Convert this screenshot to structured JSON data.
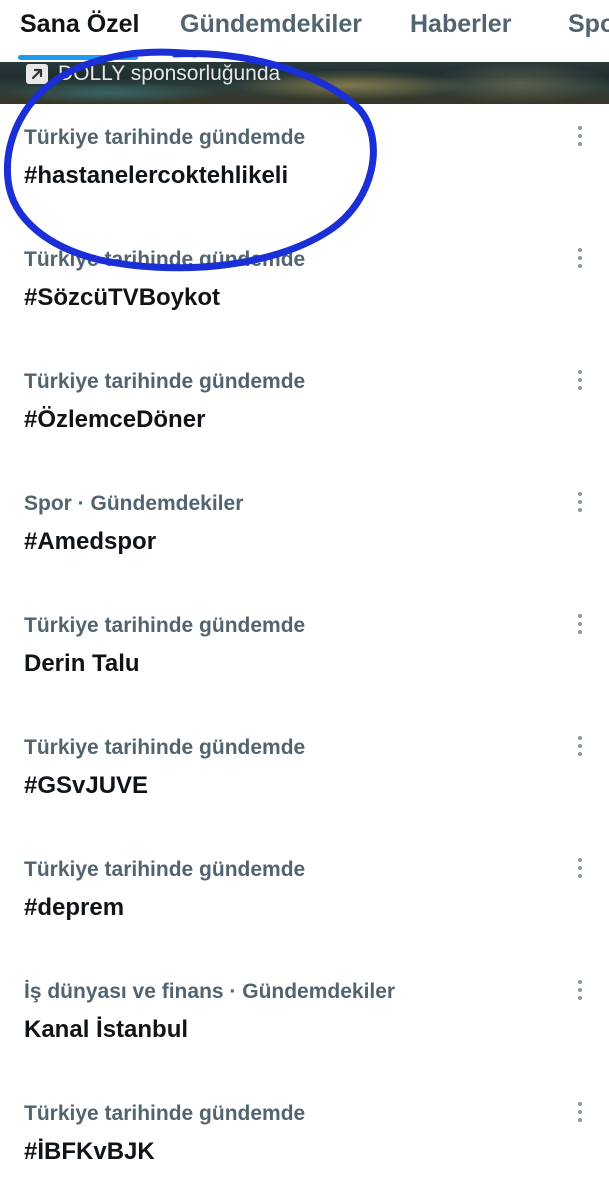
{
  "tabs": [
    {
      "label": "Sana Özel",
      "active": true
    },
    {
      "label": "Gündemdekiler",
      "active": false
    },
    {
      "label": "Haberler",
      "active": false
    },
    {
      "label": "Spor",
      "active": false
    }
  ],
  "promo": {
    "text": "DOLLY sponsorluğunda",
    "icon": "external-arrow-icon"
  },
  "trends": [
    {
      "meta": "Türkiye tarihinde gündemde",
      "title": "#hastanelercoktehlikeli"
    },
    {
      "meta": "Türkiye tarihinde gündemde",
      "title": "#SözcüTVBoykot"
    },
    {
      "meta": "Türkiye tarihinde gündemde",
      "title": "#ÖzlemceDöner"
    },
    {
      "meta": "Spor · Gündemdekiler",
      "title": "#Amedspor"
    },
    {
      "meta": "Türkiye tarihinde gündemde",
      "title": "Derin Talu"
    },
    {
      "meta": "Türkiye tarihinde gündemde",
      "title": "#GSvJUVE"
    },
    {
      "meta": "Türkiye tarihinde gündemde",
      "title": "#deprem"
    },
    {
      "meta": "İş dünyası ve finans · Gündemdekiler",
      "title": "Kanal İstanbul"
    },
    {
      "meta": "Türkiye tarihinde gündemde",
      "title": "#İBFKvBJK"
    }
  ],
  "colors": {
    "accent": "#1d9bf0",
    "highlight_stroke": "#1a2fd6",
    "text_primary": "#0f1419",
    "text_secondary": "#536471"
  }
}
